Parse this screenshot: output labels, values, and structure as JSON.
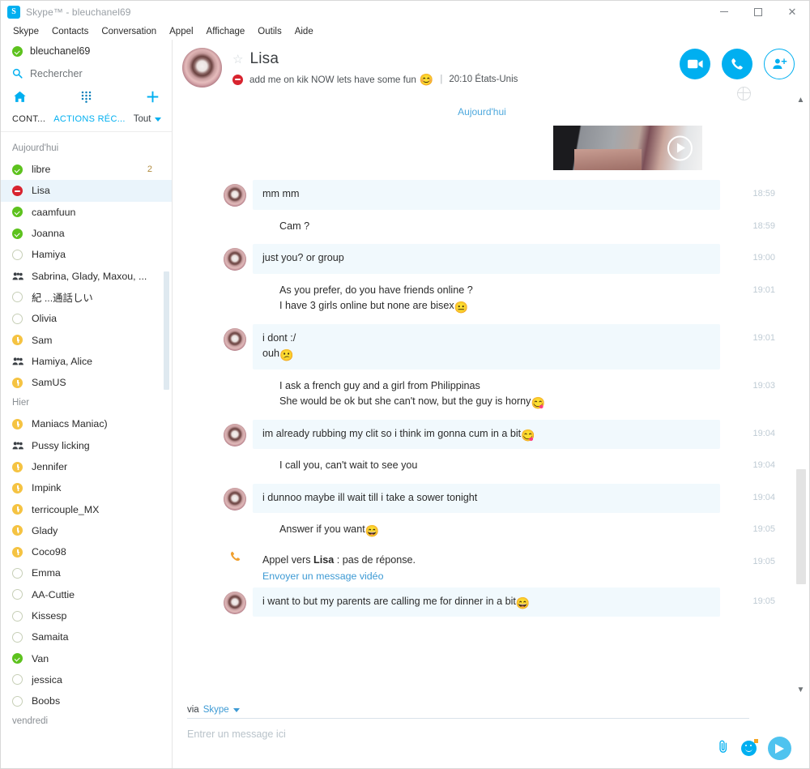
{
  "window": {
    "title": "Skype™ - bleuchanel69",
    "logo_icon": "skype-logo-icon",
    "controls": {
      "minimize": "−",
      "maximize": "□",
      "close": "×"
    }
  },
  "menubar": [
    {
      "label": "Skype"
    },
    {
      "label": "Contacts"
    },
    {
      "label": "Conversation"
    },
    {
      "label": "Appel"
    },
    {
      "label": "Affichage"
    },
    {
      "label": "Outils"
    },
    {
      "label": "Aide"
    }
  ],
  "sidebar": {
    "me": {
      "name": "bleuchanel69",
      "status": "online"
    },
    "search": {
      "placeholder": "Rechercher",
      "icon": "search-icon"
    },
    "nav_icons": [
      {
        "name": "home-icon"
      },
      {
        "name": "dialpad-icon"
      },
      {
        "name": "plus-icon"
      }
    ],
    "tabs": [
      {
        "label": "CONT...",
        "active": true
      },
      {
        "label": "ACTIONS RÉC...",
        "active": false
      }
    ],
    "filter": {
      "label": "Tout",
      "icon": "chevron-down-icon"
    },
    "groups": [
      {
        "label": "Aujourd'hui",
        "contacts": [
          {
            "name": "libre",
            "status": "online",
            "badge": "2",
            "selected": false
          },
          {
            "name": "Lisa",
            "status": "busy",
            "badge": "",
            "selected": true
          },
          {
            "name": "caamfuun",
            "status": "online",
            "badge": "",
            "selected": false
          },
          {
            "name": "Joanna",
            "status": "online",
            "badge": "",
            "selected": false
          },
          {
            "name": "Hamiya",
            "status": "offline",
            "badge": "",
            "selected": false
          },
          {
            "name": "Sabrina, Glady, Maxou, ...",
            "status": "group",
            "badge": "",
            "selected": false
          },
          {
            "name": "紀 ...通話しい",
            "status": "offline",
            "badge": "",
            "selected": false
          },
          {
            "name": "Olivia",
            "status": "offline",
            "badge": "",
            "selected": false
          },
          {
            "name": "Sam",
            "status": "away",
            "badge": "",
            "selected": false
          },
          {
            "name": "Hamiya, Alice",
            "status": "group",
            "badge": "",
            "selected": false
          },
          {
            "name": "SamUS",
            "status": "away",
            "badge": "",
            "selected": false
          }
        ]
      },
      {
        "label": "Hier",
        "contacts": [
          {
            "name": "Maniacs Maniac)",
            "status": "away",
            "badge": "",
            "selected": false
          },
          {
            "name": "Pussy licking",
            "status": "group",
            "badge": "",
            "selected": false
          },
          {
            "name": "Jennifer",
            "status": "away",
            "badge": "",
            "selected": false
          },
          {
            "name": "Impink",
            "status": "away",
            "badge": "",
            "selected": false
          },
          {
            "name": "terricouple_MX",
            "status": "away",
            "badge": "",
            "selected": false
          },
          {
            "name": "Glady",
            "status": "away",
            "badge": "",
            "selected": false
          },
          {
            "name": "Coco98",
            "status": "away",
            "badge": "",
            "selected": false
          },
          {
            "name": "Emma",
            "status": "offline",
            "badge": "",
            "selected": false
          },
          {
            "name": "AA-Cuttie",
            "status": "offline",
            "badge": "",
            "selected": false
          },
          {
            "name": "Kissesp",
            "status": "offline",
            "badge": "",
            "selected": false
          },
          {
            "name": "Samaita",
            "status": "offline",
            "badge": "",
            "selected": false
          },
          {
            "name": "Van",
            "status": "online",
            "badge": "",
            "selected": false
          },
          {
            "name": "jessica",
            "status": "offline",
            "badge": "",
            "selected": false
          },
          {
            "name": "Boobs",
            "status": "offline",
            "badge": "",
            "selected": false
          }
        ]
      },
      {
        "label": "vendredi",
        "contacts": []
      }
    ]
  },
  "chat": {
    "header": {
      "avatar": "contact-avatar",
      "favorite_icon": "star-icon",
      "name": "Lisa",
      "status": "busy",
      "mood": "add me on kik NOW lets have some fun",
      "mood_emoji": "😊",
      "separator": "|",
      "local_info": "20:10 États-Unis",
      "actions": [
        {
          "name": "video-call-button",
          "icon": "video-camera-icon"
        },
        {
          "name": "voice-call-button",
          "icon": "phone-icon"
        },
        {
          "name": "add-people-button",
          "icon": "add-person-icon"
        }
      ],
      "globe_icon": "globe-icon"
    },
    "day_divider": "Aujourd'hui",
    "video_message": {
      "play_icon": "play-icon",
      "direction": "out"
    },
    "messages": [
      {
        "direction": "in",
        "lines": [
          "mm mm"
        ],
        "emoji": "",
        "time": "18:59"
      },
      {
        "direction": "out",
        "lines": [
          "Cam ?"
        ],
        "emoji": "",
        "time": "18:59"
      },
      {
        "direction": "in",
        "lines": [
          "just you? or group"
        ],
        "emoji": "",
        "time": "19:00"
      },
      {
        "direction": "out",
        "lines": [
          "As you prefer, do you have friends online ?",
          "I have 3 girls online but none are bisex"
        ],
        "emoji": "😐",
        "time": "19:01"
      },
      {
        "direction": "in",
        "lines": [
          "i dont :/",
          "ouh"
        ],
        "emoji": "😕",
        "time": "19:01"
      },
      {
        "direction": "out",
        "lines": [
          "I ask a french guy and a girl from Philippinas",
          "She would be ok but she can't now, but the guy is horny"
        ],
        "emoji": "😋",
        "time": "19:03"
      },
      {
        "direction": "in",
        "lines": [
          "im already rubbing my clit so i think im gonna cum  in a bit"
        ],
        "emoji": "😋",
        "time": "19:04"
      },
      {
        "direction": "out",
        "lines": [
          "I call you, can't wait to see you"
        ],
        "emoji": "",
        "time": "19:04"
      },
      {
        "direction": "in",
        "lines": [
          "i dunnoo maybe ill wait till i take a sower tonight"
        ],
        "emoji": "",
        "time": "19:04"
      },
      {
        "direction": "out",
        "lines": [
          "Answer if you want"
        ],
        "emoji": "😄",
        "time": "19:05"
      }
    ],
    "call_event": {
      "icon": "phone-icon",
      "prefix": "Appel vers ",
      "contact": "Lisa",
      "suffix": " : pas de réponse.",
      "link": "Envoyer un message vidéo",
      "time": "19:05"
    },
    "last_message": {
      "direction": "in",
      "lines": [
        "i want to but my parents are calling me for dinner in a bit"
      ],
      "emoji": "😄",
      "time": "19:05"
    },
    "scrollbar": {
      "up_icon": "chevron-up-icon",
      "down_icon": "chevron-down-icon"
    }
  },
  "composer": {
    "via_label": "via",
    "via_service": "Skype",
    "via_caret_icon": "caret-down-icon",
    "input_placeholder": "Entrer un message ici",
    "actions": [
      {
        "name": "attach-file-button",
        "icon": "paperclip-icon"
      },
      {
        "name": "emoticon-button",
        "icon": "smiley-icon"
      },
      {
        "name": "send-button",
        "icon": "send-icon"
      }
    ]
  },
  "colors": {
    "accent": "#00aff0",
    "link": "#3d9ad4",
    "bubble_in": "#f1f9fd",
    "online": "#5dc21e",
    "busy": "#d8242f",
    "away": "#f5c342",
    "timestamp": "#bfcbd4"
  }
}
